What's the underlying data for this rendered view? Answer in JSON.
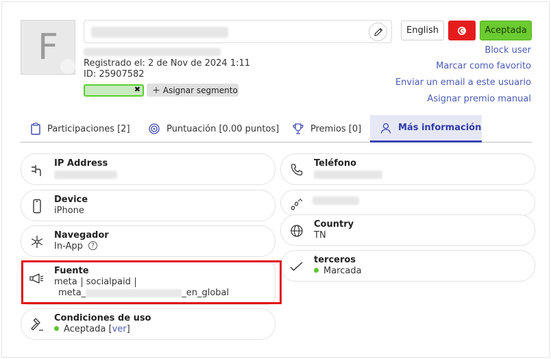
{
  "user": {
    "avatar_letter": "F",
    "registered": "Registrado el: 2 de Nov de 2024 1:11",
    "id": "ID: 25907582"
  },
  "segment": {
    "remove_label": "✖",
    "add_label": "Asignar segmento"
  },
  "header": {
    "language_label": "English",
    "status_label": "Aceptada",
    "flag_color": "#e41c1c",
    "status_color": "#6bcb30"
  },
  "actions": {
    "block": "Block user",
    "favorite": "Marcar como favorito",
    "email": "Enviar un email a este usuario",
    "prize": "Asignar premio manual"
  },
  "tabs": [
    {
      "label": "Participaciones [2]"
    },
    {
      "label": "Puntuación [0.00 puntos]"
    },
    {
      "label": "Premios [0]"
    },
    {
      "label": "Más información"
    }
  ],
  "cards": {
    "ip": {
      "title": "IP Address"
    },
    "device": {
      "title": "Device",
      "value": "iPhone"
    },
    "browser": {
      "title": "Navegador",
      "value": "In-App",
      "help": "?"
    },
    "source": {
      "title": "Fuente",
      "v1": "meta",
      "v2": "socialpaid",
      "v3a": "meta_",
      "v3b": "_en_global"
    },
    "terms": {
      "title": "Condiciones de uso",
      "value": "Aceptada",
      "bracket_open": "[",
      "link": "ver",
      "bracket_close": "]"
    },
    "phone": {
      "title": "Teléfono"
    },
    "country": {
      "title": "Country",
      "value": "TN"
    },
    "third": {
      "title": "terceros",
      "value": "Marcada"
    }
  },
  "colors": {
    "accent": "#3a45b0",
    "link": "#4a5bb5",
    "highlight": "#e01515",
    "success": "#5cc630"
  }
}
